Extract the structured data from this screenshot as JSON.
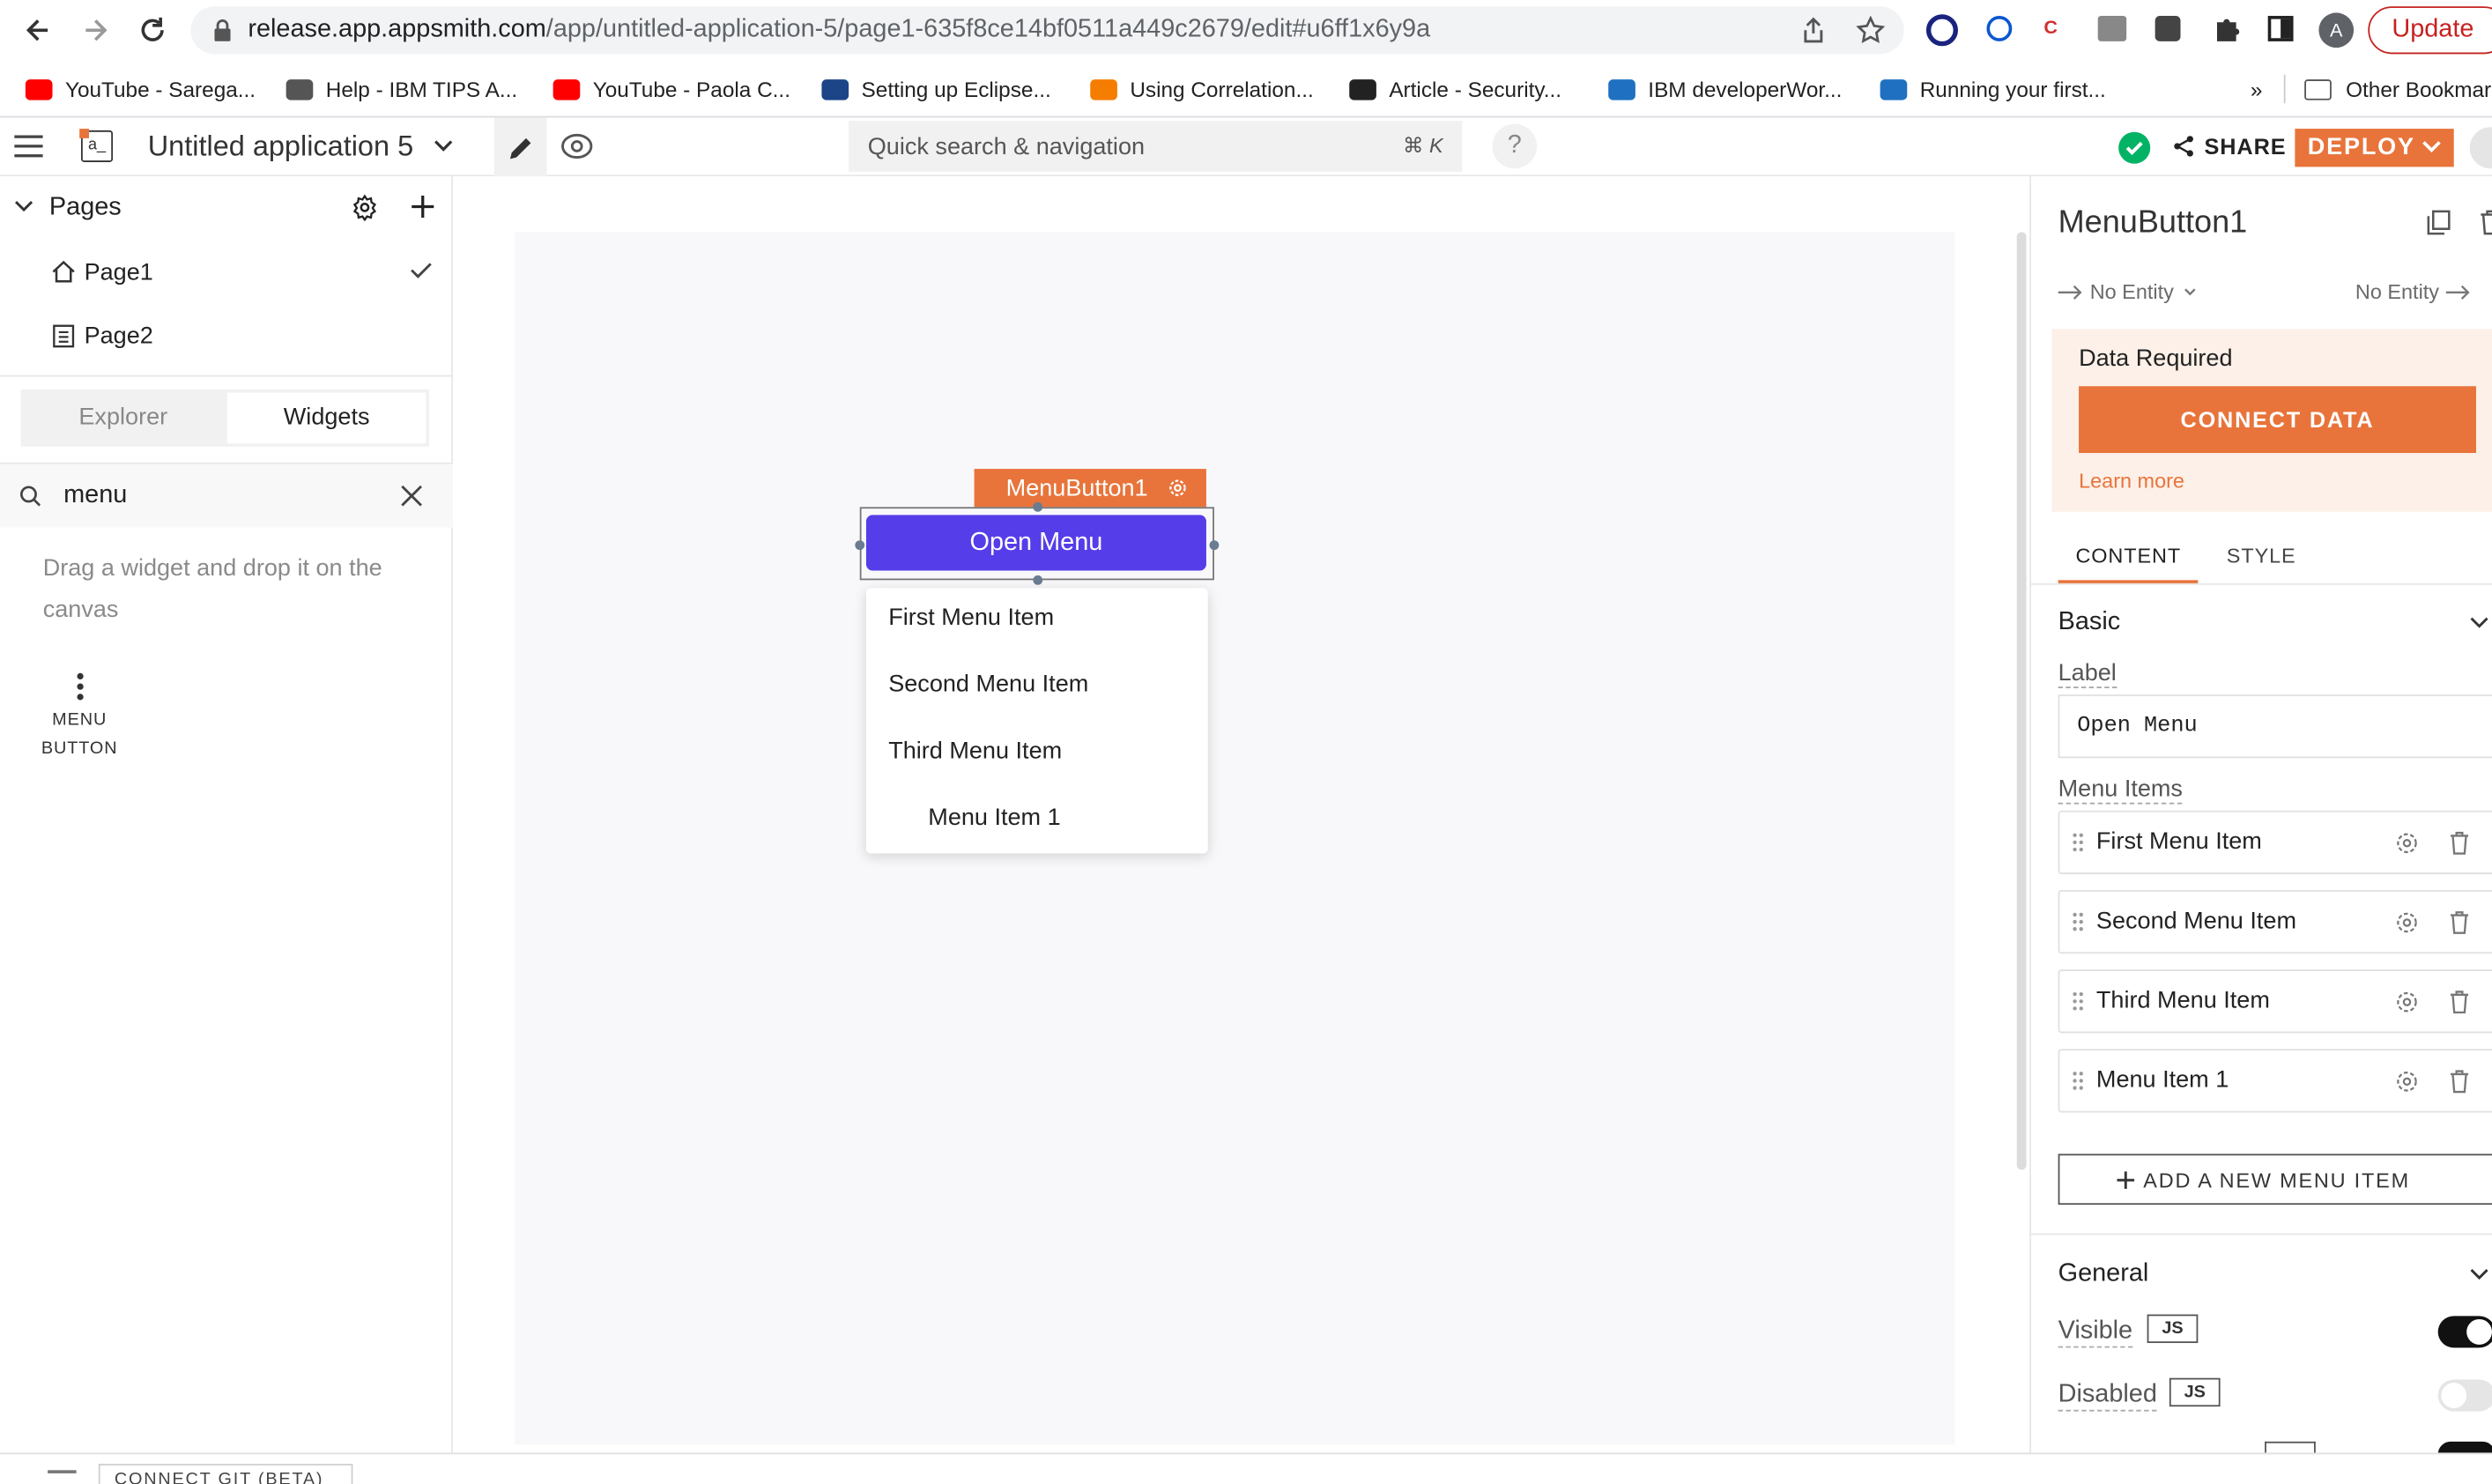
{
  "browser": {
    "url_host": "release.app.appsmith.com",
    "url_path": "/app/untitled-application-5/page1-635f8ce14bf0511a449c2679/edit#u6ff1x6y9a",
    "update_label": "Update",
    "avatar_letter": "A",
    "bookmarks": [
      {
        "label": "YouTube - Sarega...",
        "color": "#ff0000"
      },
      {
        "label": "Help - IBM TIPS A...",
        "color": "#555555"
      },
      {
        "label": "YouTube - Paola C...",
        "color": "#ff0000"
      },
      {
        "label": "Setting up Eclipse...",
        "color": "#1c4587"
      },
      {
        "label": "Using Correlation...",
        "color": "#f57d00"
      },
      {
        "label": "Article - Security...",
        "color": "#222222"
      },
      {
        "label": "IBM developerWor...",
        "color": "#1f70c1"
      },
      {
        "label": "Running your first...",
        "color": "#1f70c1"
      }
    ],
    "bookmarks_more": "»",
    "other_bookmarks": "Other Bookmarks"
  },
  "app": {
    "logo_text": "a_",
    "app_name": "Untitled application 5",
    "search_placeholder": "Quick search & navigation",
    "search_shortcut": "⌘ K",
    "help": "?",
    "share_label": "SHARE",
    "deploy_label": "DEPLOY",
    "accent_color": "#e8743b"
  },
  "left": {
    "pages_title": "Pages",
    "pages": [
      "Page1",
      "Page2"
    ],
    "tab_explorer": "Explorer",
    "tab_widgets": "Widgets",
    "search_value": "menu",
    "drag_hint": "Drag a widget and drop it on the canvas",
    "widget_label_line1": "MENU",
    "widget_label_line2": "BUTTON"
  },
  "canvas": {
    "widget_name_tag": "MenuButton1",
    "button_label": "Open Menu",
    "button_color": "#553de9",
    "dropdown_items": [
      "First Menu Item",
      "Second Menu Item",
      "Third Menu Item",
      "Menu Item 1"
    ]
  },
  "right": {
    "widget_name": "MenuButton1",
    "no_entity_left": "No Entity",
    "no_entity_right": "No Entity",
    "data_required": "Data Required",
    "connect_data": "CONNECT DATA",
    "learn_more": "Learn more",
    "tab_content": "CONTENT",
    "tab_style": "STYLE",
    "section_basic": "Basic",
    "label_title": "Label",
    "label_value": "Open Menu",
    "menu_items_title": "Menu Items",
    "menu_items": [
      "First Menu Item",
      "Second Menu Item",
      "Third Menu Item",
      "Menu Item 1"
    ],
    "add_item": "ADD A NEW MENU ITEM",
    "section_general": "General",
    "visible_label": "Visible",
    "disabled_label": "Disabled",
    "js_badge": "JS",
    "visible_on": true,
    "disabled_on": false
  },
  "status": {
    "connect_git": "CONNECT GIT (BETA)"
  }
}
